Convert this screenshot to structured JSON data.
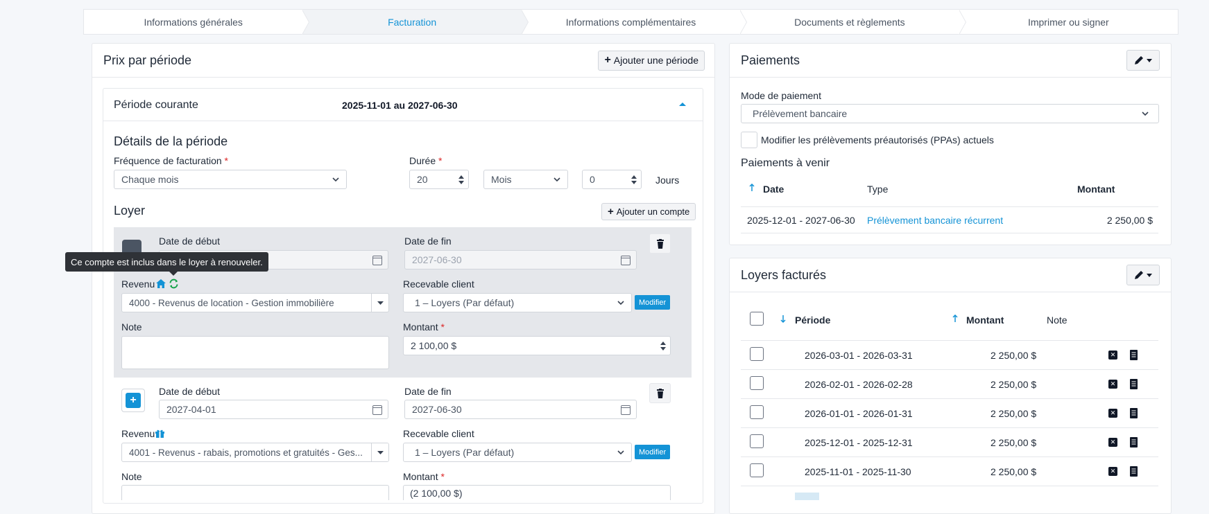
{
  "stepper": {
    "steps": [
      "Informations générales",
      "Facturation",
      "Informations complémentaires",
      "Documents et règlements",
      "Imprimer ou signer"
    ]
  },
  "price": {
    "title": "Prix par période",
    "add_period": "Ajouter une période",
    "current_label": "Période courante",
    "current_range": "2025-11-01 au 2027-06-30",
    "details_title": "Détails de la période",
    "freq_label": "Fréquence de facturation",
    "freq_value": "Chaque mois",
    "duration_label": "Durée",
    "duration_value": "20",
    "duration_unit": "Mois",
    "days_value": "0",
    "days_label": "Jours",
    "rent_title": "Loyer",
    "add_account": "Ajouter un compte",
    "required_mark": "*"
  },
  "accounts": [
    {
      "start_label": "Date de début",
      "start_value": "",
      "end_label": "Date de fin",
      "end_value": "2027-06-30",
      "revenue_label": "Revenu",
      "revenue_value": "4000 - Revenus de location - Gestion immobilière",
      "receivable_label": "Recevable client",
      "receivable_value": "1 – Loyers (Par défaut)",
      "modify": "Modifier",
      "note_label": "Note",
      "amount_label": "Montant",
      "amount_value": "2 100,00 $"
    },
    {
      "start_label": "Date de début",
      "start_value": "2027-04-01",
      "end_label": "Date de fin",
      "end_value": "2027-06-30",
      "revenue_label": "Revenu",
      "revenue_value": "4001 - Revenus - rabais, promotions et gratuités - Ges...",
      "receivable_label": "Recevable client",
      "receivable_value": "1 – Loyers (Par défaut)",
      "modify": "Modifier",
      "note_label": "Note",
      "amount_label": "Montant",
      "amount_value": "(2 100,00 $)"
    }
  ],
  "tooltip": "Ce compte est inclus dans le loyer à renouveler.",
  "payments": {
    "title": "Paiements",
    "mode_label": "Mode de paiement",
    "mode_value": "Prélèvement bancaire",
    "ppa_label": "Modifier les prélèvements préautorisés (PPAs) actuels",
    "upcoming_title": "Paiements à venir",
    "cols": [
      "Date",
      "Type",
      "Montant"
    ],
    "rows": [
      {
        "date": "2025-12-01 - 2027-06-30",
        "type": "Prélèvement bancaire récurrent",
        "amount": "2 250,00 $"
      }
    ]
  },
  "billed": {
    "title": "Loyers facturés",
    "cols": [
      "Période",
      "Montant",
      "Note"
    ],
    "rows": [
      {
        "period": "2026-03-01 - 2026-03-31",
        "amount": "2 250,00 $"
      },
      {
        "period": "2026-02-01 - 2026-02-28",
        "amount": "2 250,00 $"
      },
      {
        "period": "2026-01-01 - 2026-01-31",
        "amount": "2 250,00 $"
      },
      {
        "period": "2025-12-01 - 2025-12-31",
        "amount": "2 250,00 $"
      },
      {
        "period": "2025-11-01 - 2025-11-30",
        "amount": "2 250,00 $"
      }
    ]
  },
  "colors": {
    "accent": "#1493d6",
    "required": "#dc2626",
    "tooltip_bg": "#2f3237",
    "sync_green": "#16a34a"
  }
}
